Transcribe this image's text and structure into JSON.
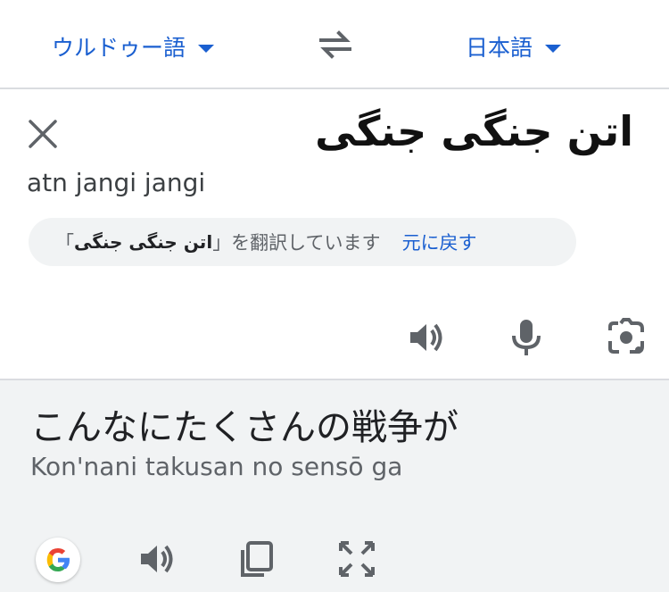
{
  "lang_bar": {
    "source_lang": "ウルドゥー語",
    "target_lang": "日本語"
  },
  "source": {
    "text": "اتن جنگی جنگی",
    "transliteration": "atn jangi jangi",
    "chip": {
      "prefix": "「",
      "original": "اتن جنگی جنگی",
      "suffix": "」を翻訳しています",
      "revert_label": "元に戻す"
    }
  },
  "result": {
    "text": "こんなにたくさんの戦争が",
    "romanization": "Kon'nani takusan no sensō ga"
  },
  "icons": {
    "close": "close-icon",
    "swap": "swap-icon",
    "speaker": "speaker-icon",
    "mic": "mic-icon",
    "camera": "camera-lens-icon",
    "google": "google-g-icon",
    "copy": "copy-icon",
    "fullscreen": "fullscreen-icon"
  },
  "colors": {
    "accent": "#1a5fd0",
    "icon": "#5f6368",
    "result_bg": "#f1f3f4"
  }
}
